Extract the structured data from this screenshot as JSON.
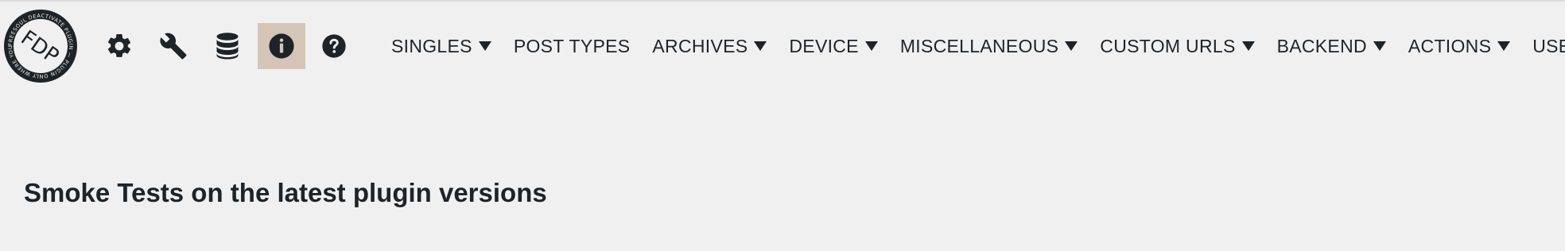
{
  "toolbar": {
    "logo": {
      "monogram": "FDP",
      "ring_text": "FREESOUL DEACTIVATE PLUGIN — PLUGIN ONLY WHERE YOU NEED IT"
    },
    "icons": [
      {
        "name": "settings-icon",
        "active": false
      },
      {
        "name": "wrench-icon",
        "active": false
      },
      {
        "name": "database-icon",
        "active": false
      },
      {
        "name": "info-icon",
        "active": true
      },
      {
        "name": "help-icon",
        "active": false
      }
    ],
    "active_color": "#d5c5b7"
  },
  "nav": {
    "items": [
      {
        "label": "SINGLES",
        "dropdown": true
      },
      {
        "label": "POST TYPES",
        "dropdown": false
      },
      {
        "label": "ARCHIVES",
        "dropdown": true
      },
      {
        "label": "DEVICE",
        "dropdown": true
      },
      {
        "label": "MISCELLANEOUS",
        "dropdown": true
      },
      {
        "label": "CUSTOM URLS",
        "dropdown": true
      },
      {
        "label": "BACKEND",
        "dropdown": true
      },
      {
        "label": "ACTIONS",
        "dropdown": true
      },
      {
        "label": "USERS",
        "dropdown": true
      }
    ]
  },
  "main": {
    "title": "Smoke Tests on the latest plugin versions"
  },
  "colors": {
    "background": "#f0f0f1",
    "text": "#1d2327",
    "icon": "#1d2327"
  }
}
